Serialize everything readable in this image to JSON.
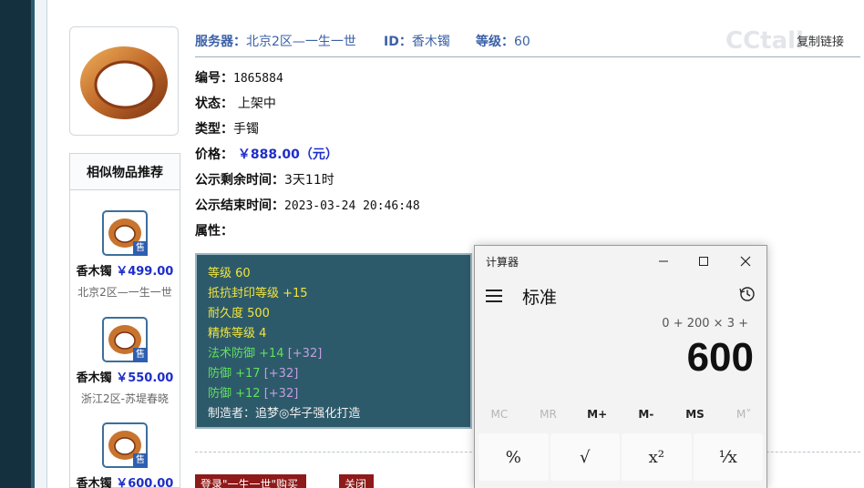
{
  "watermark": "CCtalk",
  "header": {
    "server_label": "服务器：",
    "server_value": "北京2区—一生一世",
    "id_label": "ID：",
    "id_value": "香木镯",
    "level_label": "等级：",
    "level_value": "60",
    "fav_label": "复制链接"
  },
  "info": {
    "number_label": "编号：",
    "number_value": "1865884",
    "status_label": "状态：",
    "status_value": "上架中",
    "type_label": "类型：",
    "type_value": "手镯",
    "price_label": "价格：",
    "price_value": "￥888.00（元）",
    "remaining_label": "公示剩余时间：",
    "remaining_value": "3天11时",
    "end_label": "公示结束时间：",
    "end_value": "2023-03-24 20:46:48",
    "attr_label": "属性："
  },
  "attributes": [
    {
      "text": "等级 60",
      "extra": "",
      "color": "#f2e43c"
    },
    {
      "text": "抵抗封印等级 +15",
      "extra": "",
      "color": "#f2e43c"
    },
    {
      "text": "耐久度 500",
      "extra": "",
      "color": "#f2e43c"
    },
    {
      "text": "精炼等级 4",
      "extra": "",
      "color": "#f2e43c"
    },
    {
      "text": "法术防御 +14",
      "extra": "[+32]",
      "color": "#5fe05f"
    },
    {
      "text": "防御 +17",
      "extra": "[+32]",
      "color": "#5fe05f"
    },
    {
      "text": "防御 +12",
      "extra": "[+32]",
      "color": "#5fe05f"
    },
    {
      "text": "制造者：追梦◎华子强化打造",
      "extra": "",
      "color": "#f0f0f0"
    }
  ],
  "similar": {
    "title": "相似物品推荐",
    "items": [
      {
        "name": "香木镯",
        "price": "￥499.00",
        "server": "北京2区—一生一世",
        "badge": "售"
      },
      {
        "name": "香木镯",
        "price": "￥550.00",
        "server": "浙江2区-苏堤春晓",
        "badge": "售"
      },
      {
        "name": "香木镯",
        "price": "￥600.00",
        "server": "",
        "badge": "售"
      }
    ]
  },
  "buttons": {
    "buy": "登录\"一生一世\"购买",
    "close": "关闭"
  },
  "calculator": {
    "title": "计算器",
    "mode": "标准",
    "expression": "0 + 200 × 3 +",
    "result": "600",
    "memory": [
      "MC",
      "MR",
      "M+",
      "M-",
      "MS",
      "M˅"
    ],
    "functions": [
      "%",
      "√",
      "x²",
      "¹⁄x"
    ]
  }
}
